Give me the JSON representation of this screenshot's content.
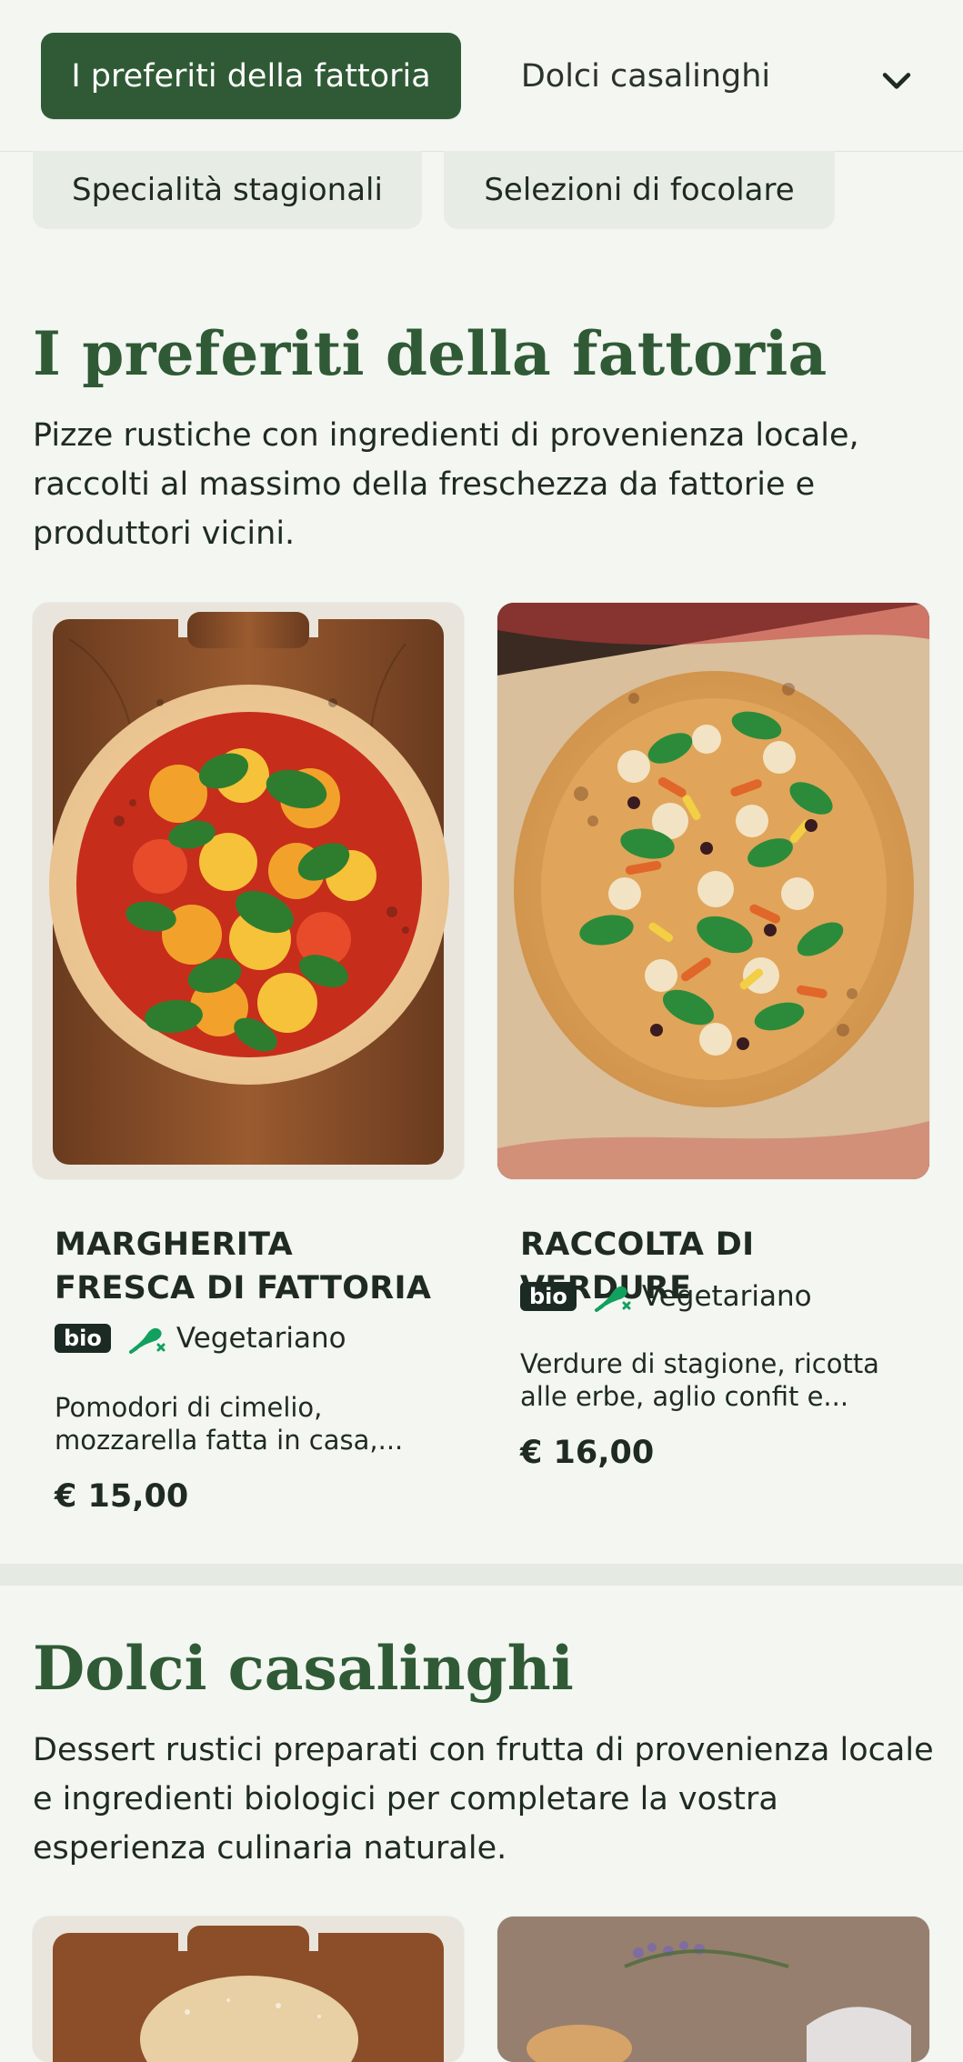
{
  "top_nav": {
    "active_tab": "I preferiti della fattoria",
    "next_tab": "Dolci casalinghi",
    "dropdown_icon": "chevron-down-icon",
    "sub_tabs": [
      "Specialità stagionali",
      "Selezioni di focolare"
    ]
  },
  "section1": {
    "title": "I preferiti della fattoria",
    "description": "Pizze rustiche con ingredienti di provenienza locale, raccolti al massimo della freschezza da fattorie e produttori vicini.",
    "cards": [
      {
        "title": "MARGHERITA FRESCA DI FATTORIA",
        "badge_bio": "bio",
        "diet_label": "Vegetariano",
        "short_desc": "Pomodori di cimelio, mozzarella fatta in casa,...",
        "price": "€ 15,00"
      },
      {
        "title": "RACCOLTA DI VERDURE",
        "badge_bio": "bio",
        "diet_label": "Vegetariano",
        "short_desc": "Verdure di stagione, ricotta alle erbe, aglio confit e...",
        "price": "€ 16,00"
      }
    ]
  },
  "section2": {
    "title": "Dolci casalinghi",
    "description": "Dessert rustici preparati con frutta di provenienza locale e ingredienti biologici per completare la vostra esperienza culinaria naturale."
  },
  "colors": {
    "primary_green": "#2f5a35",
    "background": "#f3f6f1",
    "veg_icon": "#12a05f"
  }
}
